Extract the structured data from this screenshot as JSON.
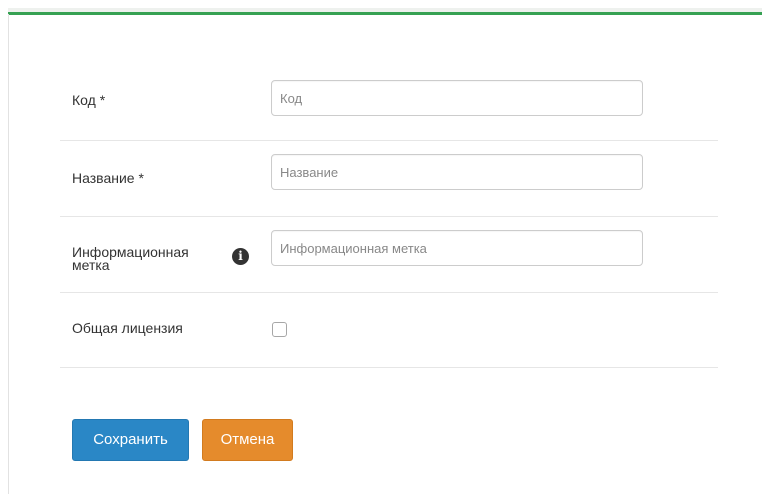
{
  "form": {
    "fields": [
      {
        "label": "Код *",
        "placeholder": "Код",
        "value": ""
      },
      {
        "label": "Название *",
        "placeholder": "Название",
        "value": ""
      },
      {
        "label_line1": "Информационная",
        "label_line2": "метка",
        "placeholder": "Информационная метка",
        "value": "",
        "icon": "info-circle-icon"
      },
      {
        "label": "Общая лицензия",
        "checked": false
      }
    ]
  },
  "actions": {
    "save_label": "Сохранить",
    "cancel_label": "Отмена"
  },
  "colors": {
    "accent": "#36a153",
    "save_button": "#2a87c6",
    "cancel_button": "#e58b2c"
  }
}
